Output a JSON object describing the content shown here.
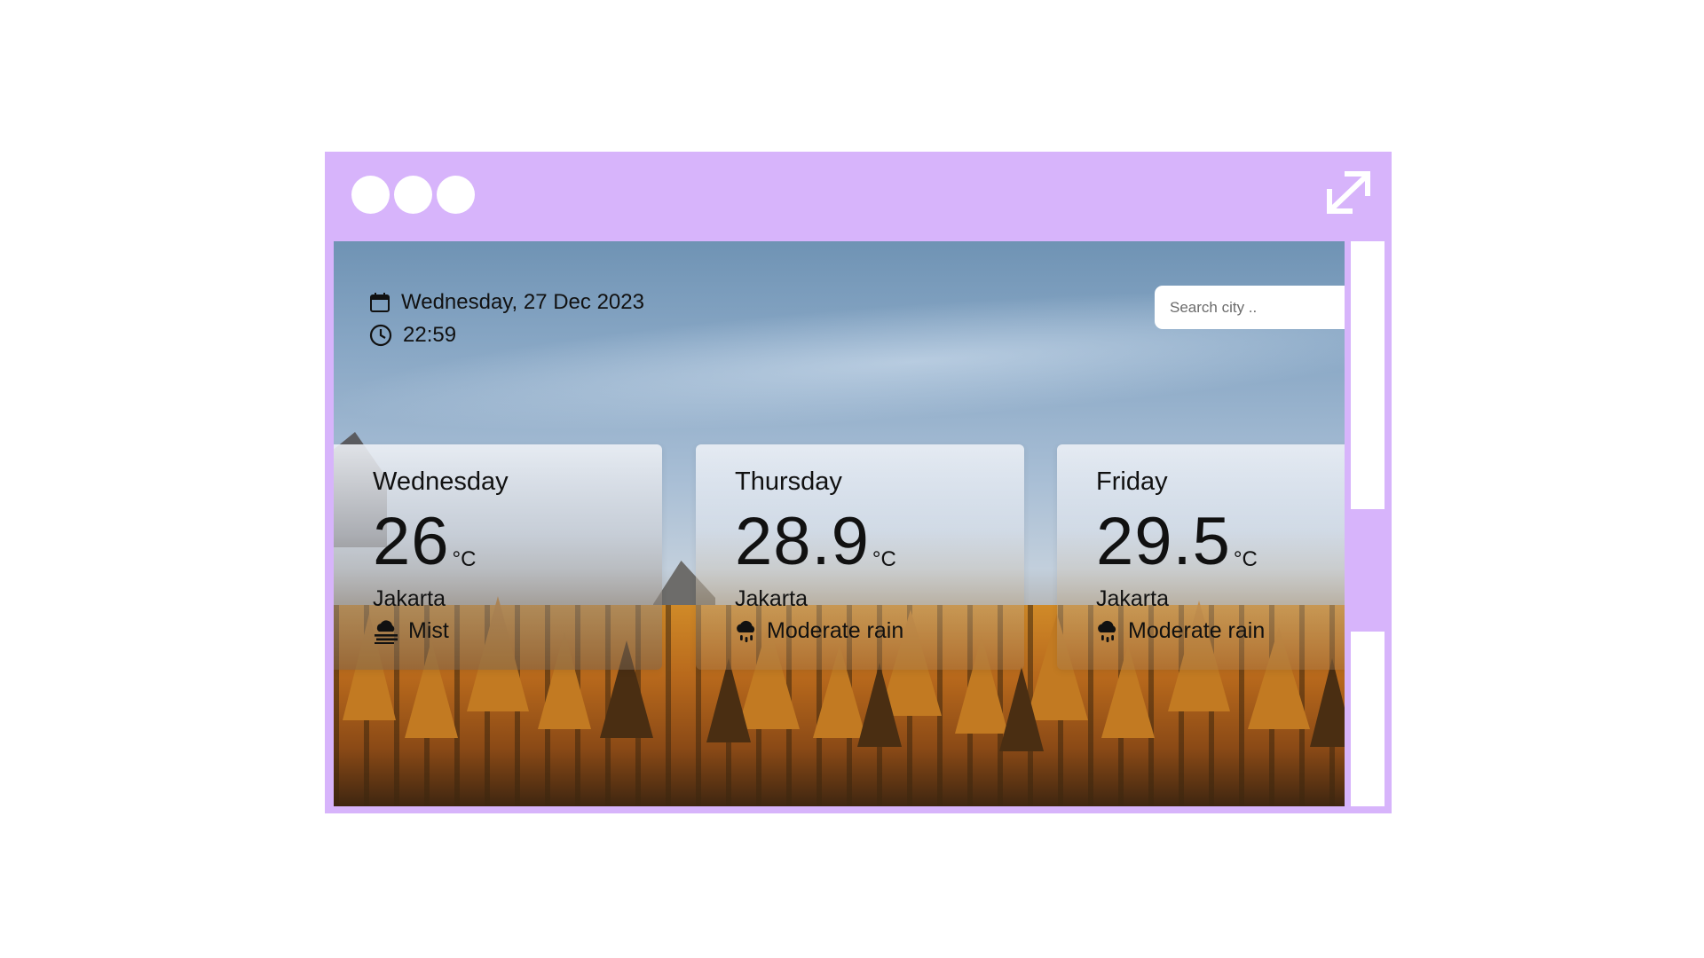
{
  "window": {
    "colors": {
      "frame": "#d7b4fb",
      "dots": "#ffffff"
    },
    "controls": [
      "window-dot",
      "window-dot",
      "window-dot"
    ],
    "expand_icon": "expand-arrows-icon"
  },
  "header": {
    "date": "Wednesday, 27 Dec 2023",
    "time": "22:59",
    "date_icon": "calendar-icon",
    "time_icon": "clock-icon"
  },
  "search": {
    "placeholder": "Search city .."
  },
  "forecast": [
    {
      "day": "Wednesday",
      "temp": "26",
      "unit": "°C",
      "city": "Jakarta",
      "condition": "Mist",
      "icon": "mist-icon"
    },
    {
      "day": "Thursday",
      "temp": "28.9",
      "unit": "°C",
      "city": "Jakarta",
      "condition": "Moderate rain",
      "icon": "rain-cloud-icon"
    },
    {
      "day": "Friday",
      "temp": "29.5",
      "unit": "°C",
      "city": "Jakarta",
      "condition": "Moderate rain",
      "icon": "rain-cloud-icon"
    }
  ]
}
